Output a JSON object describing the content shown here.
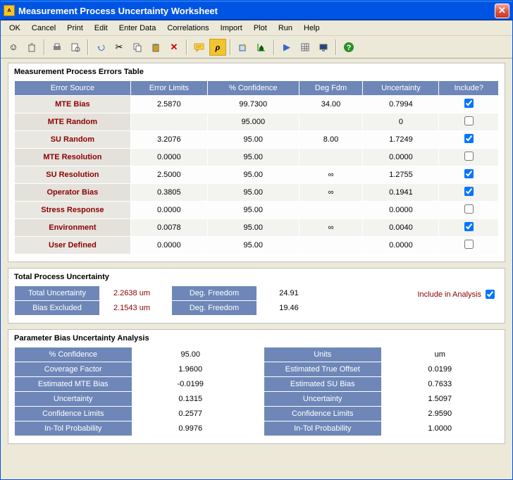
{
  "window": {
    "title": "Measurement Process Uncertainty Worksheet"
  },
  "menu": {
    "items": [
      "OK",
      "Cancel",
      "Print",
      "Edit",
      "Enter Data",
      "Correlations",
      "Import",
      "Plot",
      "Run",
      "Help"
    ]
  },
  "toolbar": {
    "icons": [
      "smiley-icon",
      "trash-icon",
      "print-icon",
      "print-preview-icon",
      "undo-icon",
      "cut-icon",
      "copy-icon",
      "paste-icon",
      "delete-icon",
      "comment-icon",
      "rho-icon",
      "export-icon",
      "chart-icon",
      "play-icon",
      "grid-icon",
      "screen-icon",
      "help-icon"
    ]
  },
  "errors_panel": {
    "title": "Measurement Process Errors Table",
    "headers": [
      "Error Source",
      "Error Limits",
      "% Confidence",
      "Deg Fdm",
      "Uncertainty",
      "Include?"
    ],
    "rows": [
      {
        "src": "MTE Bias",
        "lim": "2.5870",
        "conf": "99.7300",
        "df": "34.00",
        "unc": "0.7994",
        "inc": true
      },
      {
        "src": "MTE Random",
        "lim": "",
        "conf": "95.000",
        "df": "",
        "unc": "0",
        "inc": false
      },
      {
        "src": "SU Random",
        "lim": "3.2076",
        "conf": "95.00",
        "df": "8.00",
        "unc": "1.7249",
        "inc": true
      },
      {
        "src": "MTE Resolution",
        "lim": "0.0000",
        "conf": "95.00",
        "df": "",
        "unc": "0.0000",
        "inc": false
      },
      {
        "src": "SU Resolution",
        "lim": "2.5000",
        "conf": "95.00",
        "df": "∞",
        "unc": "1.2755",
        "inc": true
      },
      {
        "src": "Operator Bias",
        "lim": "0.3805",
        "conf": "95.00",
        "df": "∞",
        "unc": "0.1941",
        "inc": true
      },
      {
        "src": "Stress Response",
        "lim": "0.0000",
        "conf": "95.00",
        "df": "",
        "unc": "0.0000",
        "inc": false
      },
      {
        "src": "Environment",
        "lim": "0.0078",
        "conf": "95.00",
        "df": "∞",
        "unc": "0.0040",
        "inc": true
      },
      {
        "src": "User Defined",
        "lim": "0.0000",
        "conf": "95.00",
        "df": "",
        "unc": "0.0000",
        "inc": false
      }
    ]
  },
  "total_panel": {
    "title": "Total Process Uncertainty",
    "total_unc_label": "Total Uncertainty",
    "total_unc_val": "2.2638 um",
    "deg_free_label": "Deg. Freedom",
    "deg_free_val": "24.91",
    "bias_ex_label": "Bias Excluded",
    "bias_ex_val": "2.1543 um",
    "deg_free2_val": "19.46",
    "include_label": "Include in Analysis",
    "include_checked": true
  },
  "bias_panel": {
    "title": "Parameter Bias Uncertainty Analysis",
    "left": [
      {
        "label": "% Confidence",
        "val": "95.00"
      },
      {
        "label": "Coverage Factor",
        "val": "1.9600"
      },
      {
        "label": "Estimated MTE Bias",
        "val": "-0.0199"
      },
      {
        "label": "Uncertainty",
        "val": "0.1315"
      },
      {
        "label": "Confidence Limits",
        "val": "0.2577"
      },
      {
        "label": "In-Tol Probability",
        "val": "0.9976"
      }
    ],
    "right": [
      {
        "label": "Units",
        "val": "um"
      },
      {
        "label": "Estimated True Offset",
        "val": "0.0199"
      },
      {
        "label": "Estimated SU Bias",
        "val": "0.7633"
      },
      {
        "label": "Uncertainty",
        "val": "1.5097"
      },
      {
        "label": "Confidence Limits",
        "val": "2.9590"
      },
      {
        "label": "In-Tol Probability",
        "val": "1.0000"
      }
    ]
  }
}
